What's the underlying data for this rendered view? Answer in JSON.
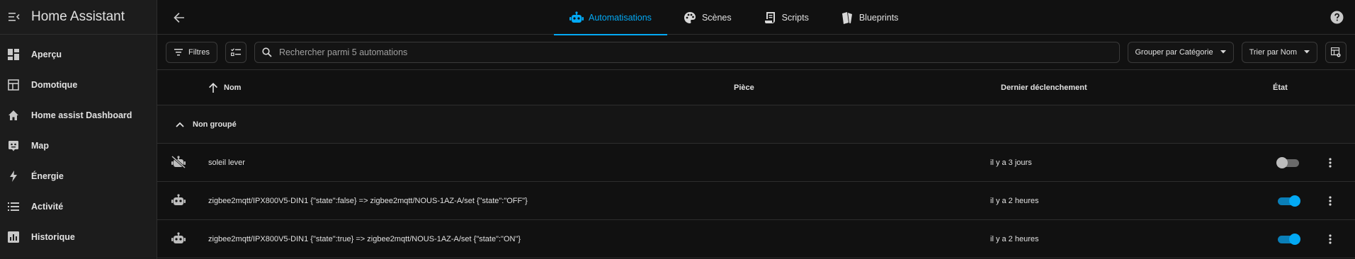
{
  "app": {
    "title": "Home Assistant"
  },
  "sidebar": {
    "items": [
      {
        "label": "Aperçu",
        "icon": "dashboard-icon"
      },
      {
        "label": "Domotique",
        "icon": "view-dashboard-icon"
      },
      {
        "label": "Home assist Dashboard",
        "icon": "home-icon"
      },
      {
        "label": "Map",
        "icon": "map-icon"
      },
      {
        "label": "Énergie",
        "icon": "lightning-icon"
      },
      {
        "label": "Activité",
        "icon": "list-icon"
      },
      {
        "label": "Historique",
        "icon": "chart-box-icon"
      }
    ]
  },
  "tabs": [
    {
      "label": "Automatisations",
      "icon": "robot-icon",
      "active": true
    },
    {
      "label": "Scènes",
      "icon": "palette-icon",
      "active": false
    },
    {
      "label": "Scripts",
      "icon": "script-icon",
      "active": false
    },
    {
      "label": "Blueprints",
      "icon": "blueprint-icon",
      "active": false
    }
  ],
  "filters": {
    "filters_label": "Filtres",
    "search_placeholder": "Rechercher parmi 5 automations",
    "group_by_label": "Grouper par Catégorie",
    "sort_by_label": "Trier par Nom"
  },
  "table": {
    "columns": {
      "name": "Nom",
      "area": "Pièce",
      "last_triggered": "Dernier déclenchement",
      "state": "État"
    },
    "group_label": "Non groupé",
    "rows": [
      {
        "name": "soleil lever",
        "last_triggered": "il y a 3 jours",
        "enabled": false,
        "icon": "robot-off-icon"
      },
      {
        "name": "zigbee2mqtt/IPX800V5-DIN1 {\"state\":false} => zigbee2mqtt/NOUS-1AZ-A/set {\"state\":\"OFF\"}",
        "last_triggered": "il y a 2 heures",
        "enabled": true,
        "icon": "robot-icon"
      },
      {
        "name": "zigbee2mqtt/IPX800V5-DIN1 {\"state\":true} => zigbee2mqtt/NOUS-1AZ-A/set {\"state\":\"ON\"}",
        "last_triggered": "il y a 2 heures",
        "enabled": true,
        "icon": "robot-icon"
      }
    ]
  },
  "colors": {
    "accent": "#03a9f4",
    "background": "#111111",
    "sidebar": "#1c1c1c"
  }
}
